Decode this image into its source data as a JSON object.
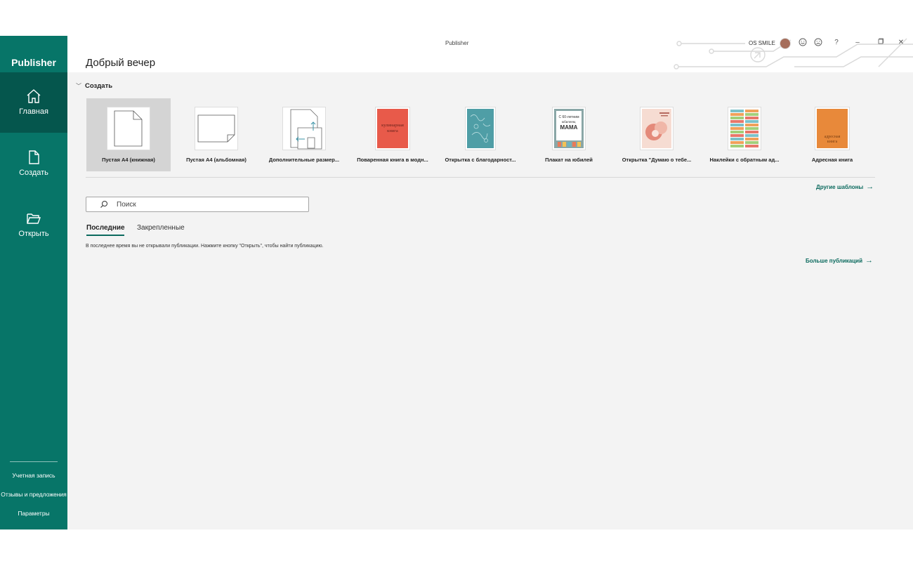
{
  "window": {
    "title": "Publisher"
  },
  "sidebar": {
    "brand": "Publisher",
    "nav": [
      {
        "label": "Главная",
        "icon": "home-icon"
      },
      {
        "label": "Создать",
        "icon": "new-document-icon"
      },
      {
        "label": "Открыть",
        "icon": "open-folder-icon"
      }
    ],
    "footer": [
      "Учетная запись",
      "Отзывы и предложения",
      "Параметры"
    ]
  },
  "header": {
    "greeting": "Добрый вечер",
    "account_name": "OS SMILE",
    "buttons": {
      "help": "?",
      "minimize": "–",
      "restore": "🗗",
      "close": "✕"
    }
  },
  "create": {
    "heading": "Создать",
    "templates": [
      {
        "label": "Пустая А4 (книжная)",
        "selected": true
      },
      {
        "label": "Пустая А4 (альбомная)"
      },
      {
        "label": "Дополнительные размер..."
      },
      {
        "label": "Поваренная книга в модн...",
        "cover_text": "кулинарная книга",
        "color": "#e85a4a"
      },
      {
        "label": "Открытка с благодарност...",
        "color": "#4f9ea6"
      },
      {
        "label": "Плакат на юбилей",
        "cover_text": "С 60-летним юбилеем, МАМА"
      },
      {
        "label": "Открытка \"Думаю о тебе..."
      },
      {
        "label": "Наклейки с обратным ад..."
      },
      {
        "label": "Адресная книга",
        "cover_text": "адресная книга",
        "color": "#e8893a"
      }
    ],
    "more_templates": "Другие шаблоны"
  },
  "search": {
    "placeholder": "Поиск"
  },
  "tabs": [
    "Последние",
    "Закрепленные"
  ],
  "recent": {
    "empty_message": "В последнее время вы не открывали публикации. Нажмите кнопку \"Открыть\", чтобы найти публикацию.",
    "more_link": "Больше публикаций"
  },
  "colors": {
    "accent": "#077568",
    "accent_dark": "#05564d",
    "link": "#0b6a5e"
  }
}
